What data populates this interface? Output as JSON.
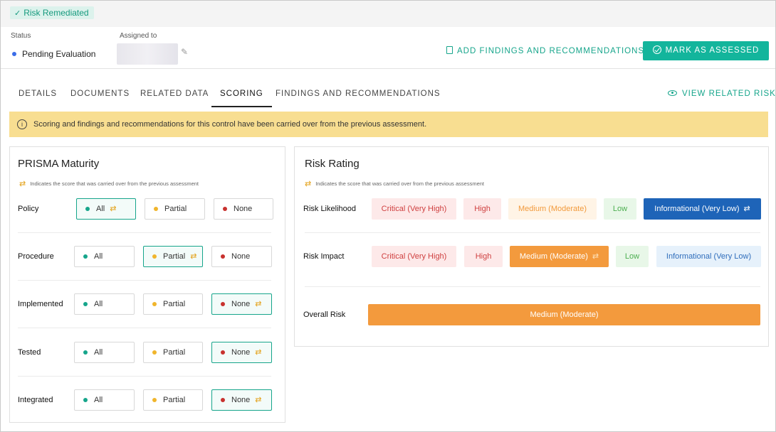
{
  "header": {
    "badge": "Risk Remediated",
    "status_label": "Status",
    "status_value": "Pending Evaluation",
    "assigned_label": "Assigned to",
    "add_findings": "ADD FINDINGS AND RECOMMENDATIONS",
    "mark_assessed": "MARK AS ASSESSED"
  },
  "tabs": [
    "DETAILS",
    "DOCUMENTS",
    "RELATED DATA",
    "SCORING",
    "FINDINGS AND RECOMMENDATIONS"
  ],
  "active_tab": "SCORING",
  "view_related_risk": "VIEW RELATED RISK",
  "notice": "Scoring and findings and recommendations for this control have been carried over from the previous assessment.",
  "prisma": {
    "title": "PRISMA Maturity",
    "carry_note": "Indicates the score that was carried over from the previous assessment",
    "options": [
      "All",
      "Partial",
      "None"
    ],
    "rows": [
      {
        "label": "Policy",
        "selected": "All"
      },
      {
        "label": "Procedure",
        "selected": "Partial"
      },
      {
        "label": "Implemented",
        "selected": "None"
      },
      {
        "label": "Tested",
        "selected": "None"
      },
      {
        "label": "Integrated",
        "selected": "None"
      }
    ]
  },
  "risk": {
    "title": "Risk Rating",
    "carry_note": "Indicates the score that was carried over from the previous assessment",
    "levels": [
      "Critical (Very High)",
      "High",
      "Medium (Moderate)",
      "Low",
      "Informational (Very Low)"
    ],
    "likelihood_label": "Risk Likelihood",
    "likelihood_selected": "Informational (Very Low)",
    "impact_label": "Risk Impact",
    "impact_selected": "Medium (Moderate)",
    "overall_label": "Overall Risk",
    "overall_value": "Medium (Moderate)"
  },
  "colors": {
    "accent": "#13b59c",
    "notice_bg": "#f8de91",
    "selected_info": "#1e64b8",
    "moderate": "#f39a3d"
  }
}
